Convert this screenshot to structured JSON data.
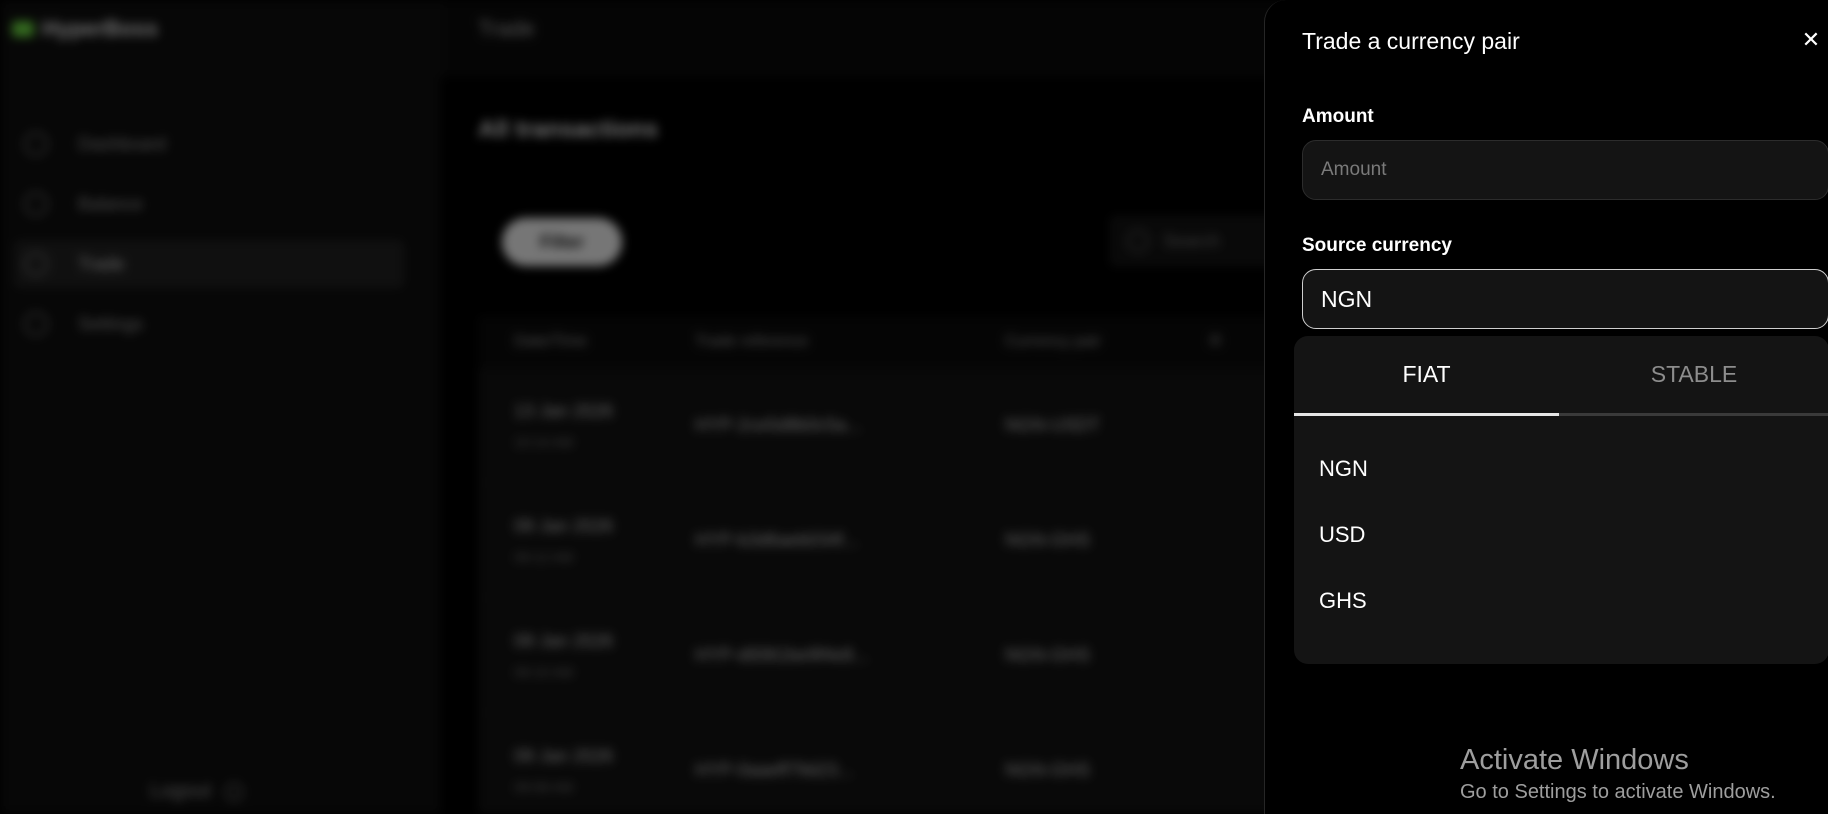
{
  "background": {
    "logo_text": "HyperBoss",
    "page_crumb": "Trade",
    "nav": [
      {
        "label": "Dashboard",
        "icon": "home-icon"
      },
      {
        "label": "Balance",
        "icon": "wallet-icon"
      },
      {
        "label": "Trade",
        "icon": "trade-icon",
        "active": true
      },
      {
        "label": "Settings",
        "icon": "gear-icon"
      }
    ],
    "logout_label": "Logout",
    "section_title": "All transactions",
    "filter_label": "Filter",
    "search_placeholder": "Search",
    "table": {
      "headers": [
        "Date/Time",
        "Trade reference",
        "Currency pair",
        "R"
      ],
      "rows": [
        {
          "date": "13 Jan 2026",
          "time": "10:14 AM",
          "ref": "HYP-2ce5d8b0c5a...",
          "pair": "NGN-USDT"
        },
        {
          "date": "09 Jan 2026",
          "time": "09:12 AM",
          "ref": "HYP-b3d6aeb034f...",
          "pair": "NGN-GHS"
        },
        {
          "date": "09 Jan 2026",
          "time": "09:10 AM",
          "ref": "HYP-d0061be9f4e8...",
          "pair": "NGN-GHS"
        },
        {
          "date": "09 Jan 2026",
          "time": "09:08 AM",
          "ref": "HYP-0aaeff79d23...",
          "pair": "NGN-GHS"
        }
      ]
    }
  },
  "drawer": {
    "title": "Trade a currency pair",
    "amount": {
      "label": "Amount",
      "placeholder": "Amount",
      "value": ""
    },
    "source_currency": {
      "label": "Source currency",
      "selected": "NGN"
    },
    "dropdown": {
      "tabs": [
        {
          "label": "FIAT",
          "active": true
        },
        {
          "label": "STABLE",
          "active": false
        }
      ],
      "options": [
        "NGN",
        "USD",
        "GHS"
      ]
    }
  },
  "watermark": {
    "title": "Activate Windows",
    "subtitle": "Go to Settings to activate Windows."
  }
}
